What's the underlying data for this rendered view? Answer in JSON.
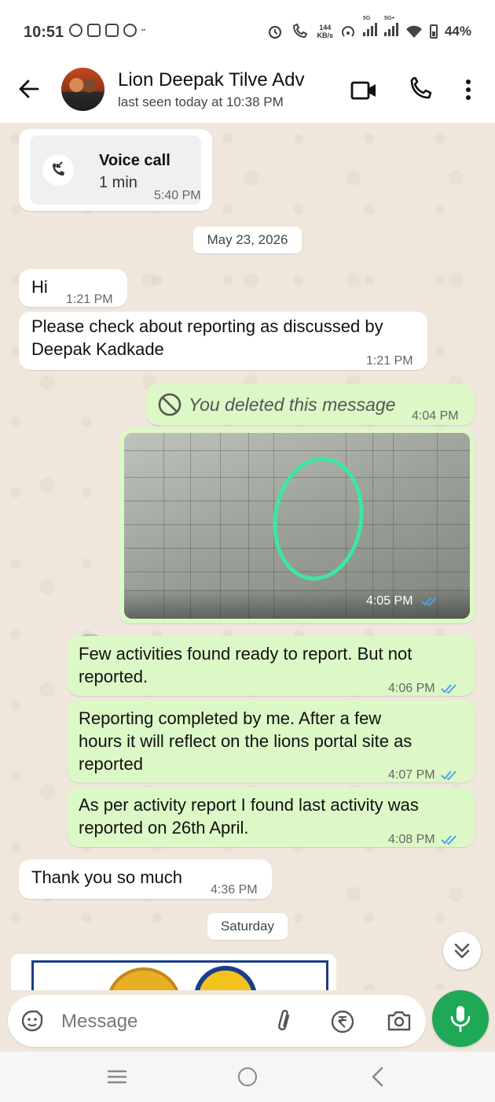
{
  "status_bar": {
    "time": "10:51",
    "network_rate_value": "144",
    "network_rate_unit": "KB/s",
    "network_5g_a": "5G",
    "network_5g_b": "5G+",
    "battery": "44%"
  },
  "header": {
    "contact_name": "Lion Deepak Tilve Adv",
    "last_seen": "last seen today at 10:38 PM"
  },
  "messages": {
    "voice_call": {
      "title": "Voice call",
      "duration": "1 min",
      "time": "5:40 PM"
    },
    "date_1": "May 23, 2026",
    "hi": {
      "text": "Hi",
      "time": "1:21 PM"
    },
    "check": {
      "text": "Please check about reporting as discussed by Deepak Kadkade",
      "line1": "Please check about reporting as discussed by",
      "line2": "Deepak Kadkade",
      "time": "1:21 PM"
    },
    "deleted": {
      "text": "You deleted this message",
      "time": "4:04 PM"
    },
    "photo": {
      "time": "4:05 PM"
    },
    "few": {
      "line1": "Few activities found ready to report. But not",
      "line2": "reported.",
      "time": "4:06 PM"
    },
    "completed": {
      "line1": "Reporting completed by me. After a few",
      "line2": "hours it will reflect on the lions portal site as",
      "line3": "reported",
      "time": "4:07 PM"
    },
    "per_activity": {
      "line1": "As per activity report I found last activity was",
      "line2": "reported on 26th April.",
      "time": "4:08 PM"
    },
    "thanks": {
      "text": "Thank you so much",
      "time": "4:36 PM"
    },
    "date_2": "Saturday"
  },
  "input": {
    "placeholder": "Message"
  },
  "colors": {
    "outgoing_bubble": "#dcf8c6",
    "incoming_bubble": "#ffffff",
    "chat_background": "#efe7dc",
    "accent_green": "#1fa855",
    "read_ticks": "#4fa3e8"
  }
}
